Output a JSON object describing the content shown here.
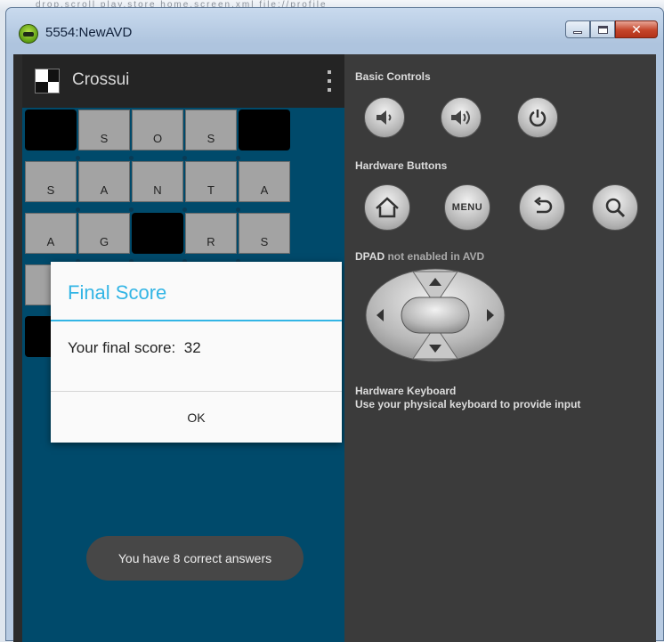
{
  "window": {
    "title": "5554:NewAVD"
  },
  "background_strip": {
    "text": "drop.scroll  play.store  home.screen.xml  file://profile"
  },
  "app": {
    "title": "Crossui",
    "grid_rows": [
      [
        "#",
        "S",
        "O",
        "S",
        "#"
      ],
      [
        "S",
        "A",
        "N",
        "T",
        "A"
      ],
      [
        "A",
        "G",
        "#",
        "R",
        "S"
      ],
      [
        "",
        "",
        "",
        "",
        ""
      ],
      [
        "#",
        "",
        "",
        "",
        ""
      ]
    ]
  },
  "dialog": {
    "title": "Final Score",
    "message_label": "Your final score:",
    "score": "32",
    "ok_label": "OK"
  },
  "toast": {
    "text": "You have 8 correct answers"
  },
  "controls": {
    "basic_controls_label": "Basic Controls",
    "hardware_buttons_label": "Hardware Buttons",
    "menu_label": "MENU",
    "dpad_label_prefix": "DPAD",
    "dpad_label_suffix": "not enabled in AVD",
    "keyboard_label": "Hardware Keyboard",
    "keyboard_hint": "Use your physical keyboard to provide input"
  },
  "colors": {
    "accent": "#33b5e5",
    "phone_background": "#004a6b",
    "panel_background": "#3b3b3b"
  }
}
